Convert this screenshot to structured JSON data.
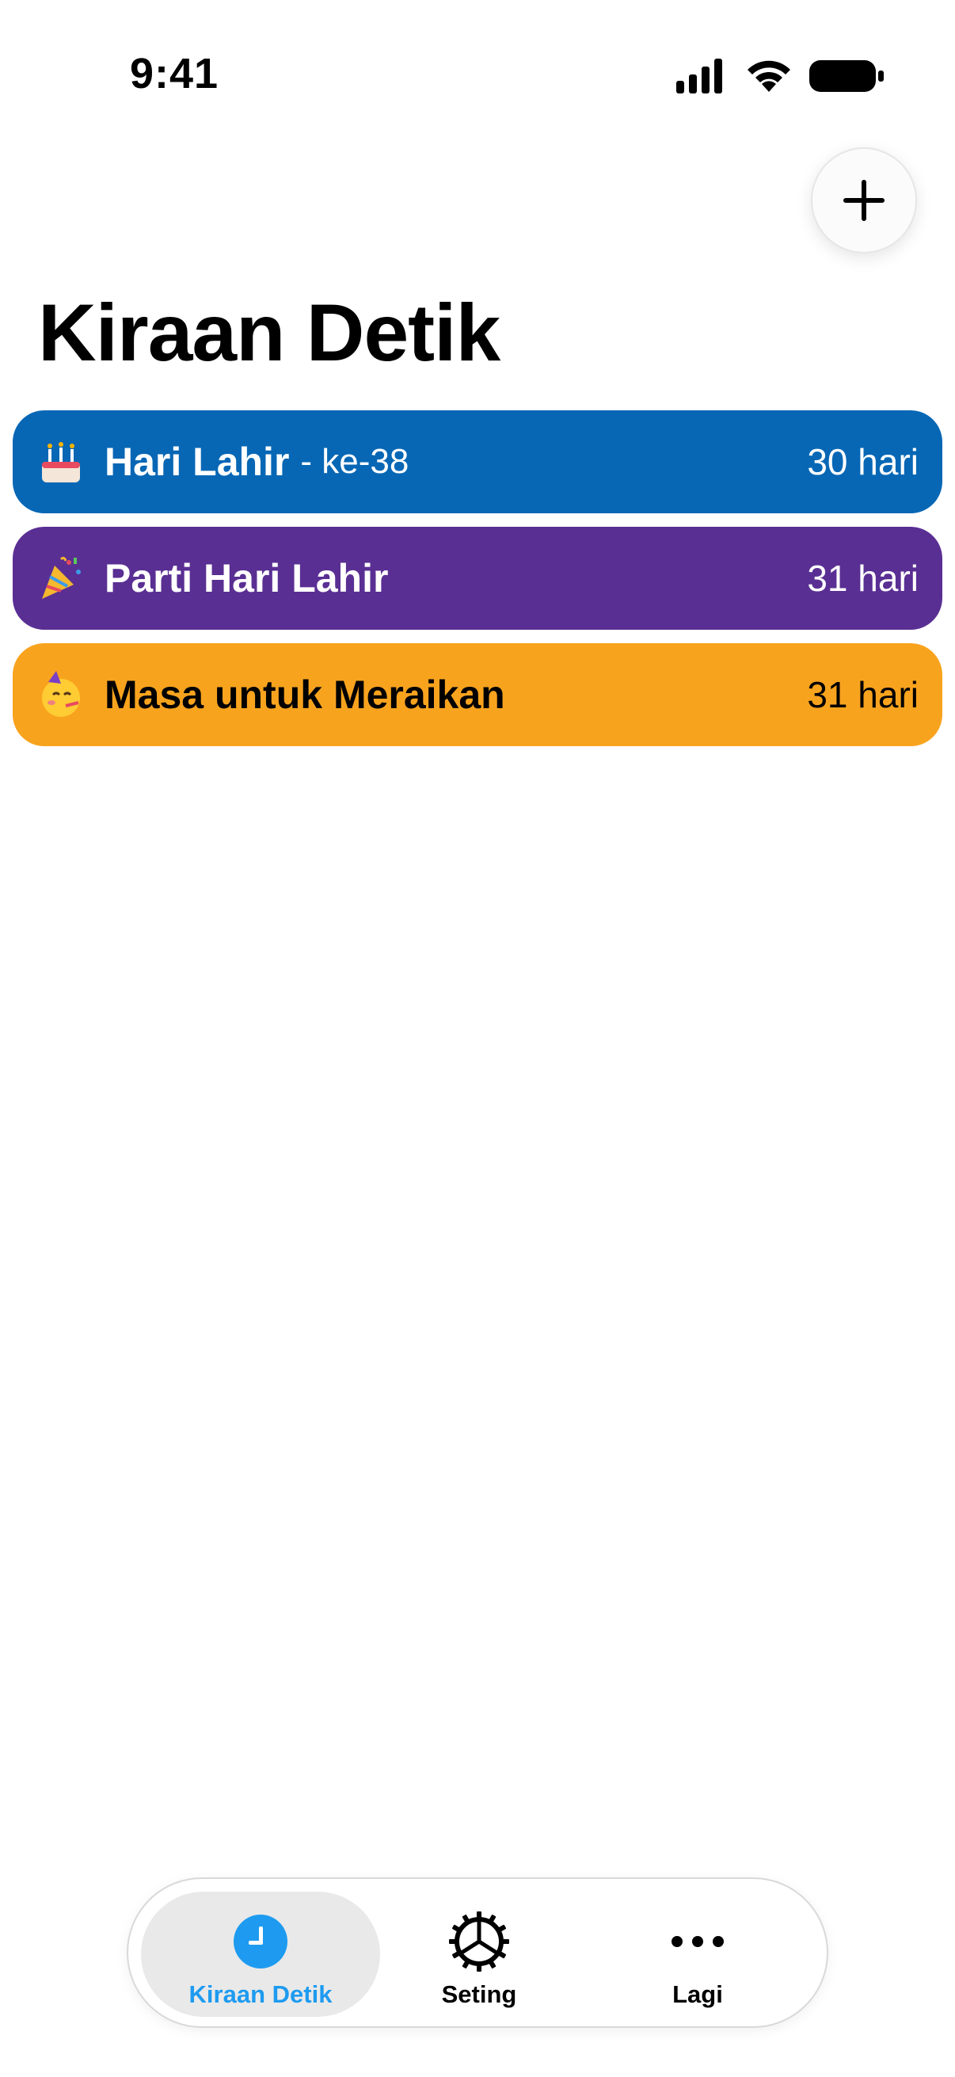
{
  "status_bar": {
    "time": "9:41",
    "icons": [
      "cellular-signal-icon",
      "wifi-icon",
      "battery-icon"
    ]
  },
  "header": {
    "add_icon": "plus-icon",
    "title": "Kiraan Detik"
  },
  "countdowns": [
    {
      "emoji": "birthday-cake-icon",
      "name": "Hari Lahir",
      "suffix": "- ke-38",
      "days": "30 hari",
      "color": "#0767B5",
      "text_color": "#ffffff"
    },
    {
      "emoji": "party-popper-icon",
      "name": "Parti Hari Lahir",
      "suffix": "",
      "days": "31 hari",
      "color": "#5A2F93",
      "text_color": "#ffffff"
    },
    {
      "emoji": "partying-face-icon",
      "name": "Masa untuk Meraikan",
      "suffix": "",
      "days": "31 hari",
      "color": "#F8A31E",
      "text_color": "#000000"
    }
  ],
  "tab_bar": {
    "active_tab": 0,
    "accent_color": "#1e9bf0",
    "tabs": [
      {
        "label": "Kiraan Detik",
        "icon": "clock-icon"
      },
      {
        "label": "Seting",
        "icon": "gear-icon"
      },
      {
        "label": "Lagi",
        "icon": "more-dots-icon"
      }
    ]
  }
}
